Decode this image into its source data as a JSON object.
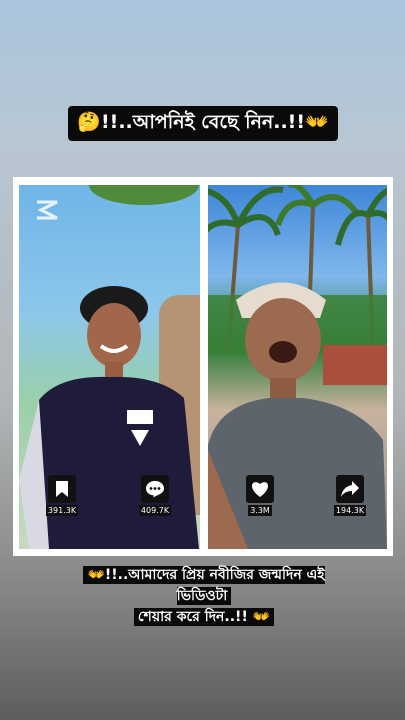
{
  "captions": {
    "top": "🤔!!..আপনিই বেছে নিন..!!👐",
    "bottom_line1": "👐!!..আমাদের প্রিয় নবীজির জন্মদিন এই ভিডিওটা",
    "bottom_line2": "শেয়ার করে দিন..!! 👐"
  },
  "left_video": {
    "stats": [
      {
        "icon": "bookmark-icon",
        "value": "391.3K"
      },
      {
        "icon": "comment-icon",
        "value": "409.7K"
      }
    ]
  },
  "right_video": {
    "stats": [
      {
        "icon": "heart-icon",
        "value": "3.3M"
      },
      {
        "icon": "share-icon",
        "value": "194.3K"
      }
    ]
  }
}
